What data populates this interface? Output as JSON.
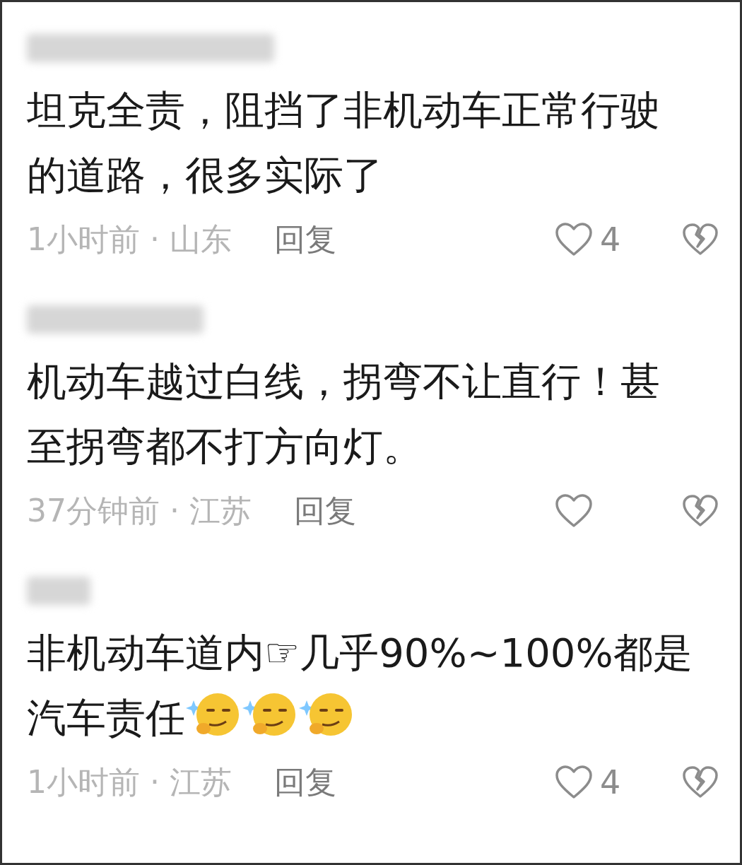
{
  "comments": [
    {
      "text": "坦克全责，阻挡了非机动车正常行驶的道路，很多实际了",
      "meta": "1小时前 · 山东",
      "reply": "回复",
      "likes": "4"
    },
    {
      "text": "机动车越过白线，拐弯不让直行！甚至拐弯都不打方向灯。",
      "meta": "37分钟前 · 江苏",
      "reply": "回复"
    },
    {
      "text": "非机动车道内☞几乎90%~100%都是汽车责任",
      "emojis": true,
      "meta": "1小时前 · 江苏",
      "reply": "回复",
      "likes": "4"
    }
  ]
}
